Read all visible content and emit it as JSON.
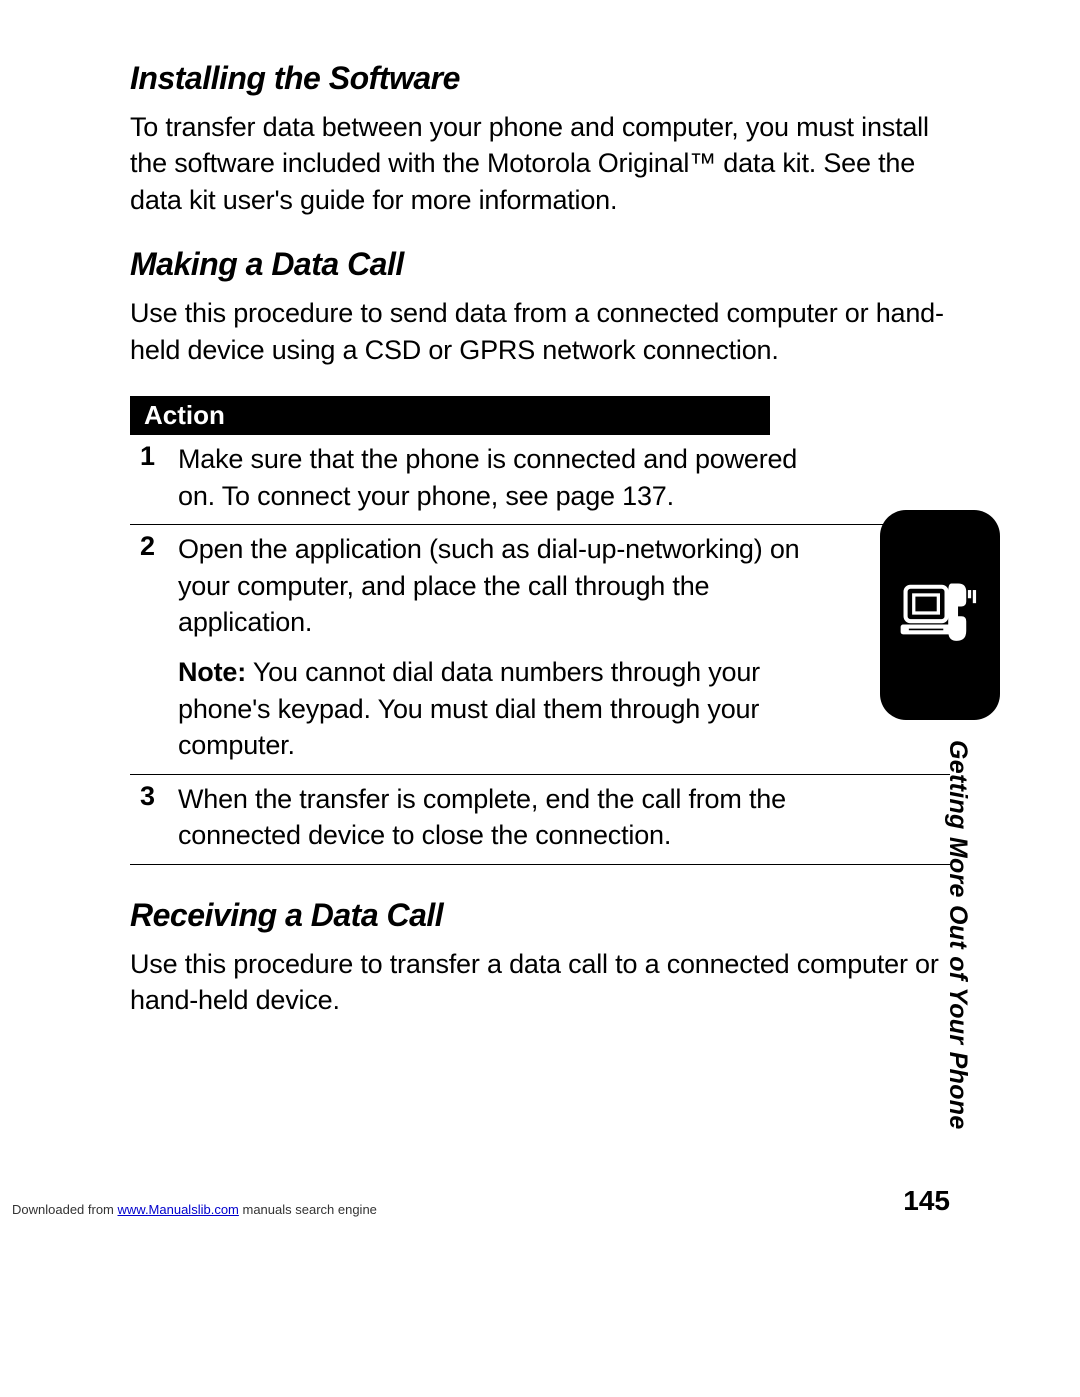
{
  "sections": {
    "s1": {
      "heading": "Installing the Software",
      "body": "To transfer data between your phone and computer, you must install the software included with the Motorola Original™ data kit. See the data kit user's guide for more information."
    },
    "s2": {
      "heading": "Making a Data Call",
      "body": "Use this procedure to send data from a connected computer or hand-held device using a CSD or GPRS network connection."
    },
    "s3": {
      "heading": "Receiving a Data Call",
      "body": "Use this procedure to transfer a data call to a connected computer or hand-held device."
    }
  },
  "action": {
    "header": "Action",
    "steps": [
      {
        "n": "1",
        "text": "Make sure that the phone is connected and powered on. To connect your phone, see page 137."
      },
      {
        "n": "2",
        "text": "Open the application (such as dial-up-networking) on your computer, and place the call through the application.",
        "note_label": "Note:",
        "note": " You cannot dial data numbers through your phone's keypad. You must dial them through your computer."
      },
      {
        "n": "3",
        "text": "When the transfer is complete, end the call from the connected device to close the connection."
      }
    ]
  },
  "side_label": "Getting More Out of Your Phone",
  "page_number": "145",
  "footer": {
    "prefix": "Downloaded from ",
    "link": "www.Manualslib.com",
    "suffix": " manuals search engine"
  }
}
